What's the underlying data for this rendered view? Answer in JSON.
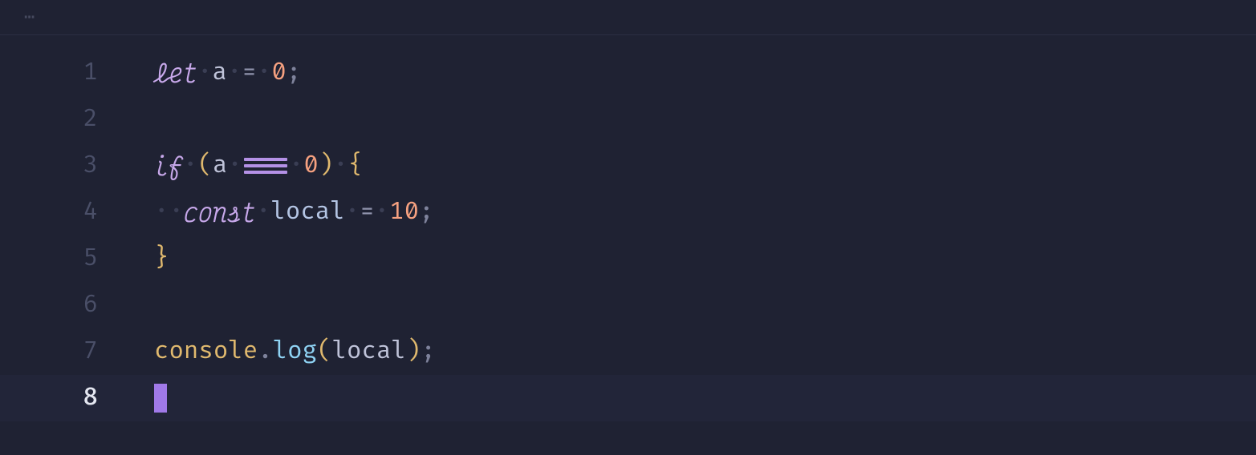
{
  "tabbar": {
    "ellipsis": "⋯"
  },
  "lines": [
    {
      "num": "1"
    },
    {
      "num": "2"
    },
    {
      "num": "3"
    },
    {
      "num": "4"
    },
    {
      "num": "5"
    },
    {
      "num": "6"
    },
    {
      "num": "7"
    },
    {
      "num": "8"
    }
  ],
  "code": {
    "l1": {
      "kw": "let",
      "sp": "·",
      "ident": "a",
      "op_eq": "=",
      "num": "0",
      "semi": ";"
    },
    "l3": {
      "kw": "if",
      "sp": "·",
      "lp": "(",
      "ident": "a",
      "num": "0",
      "rp": ")",
      "lb": "{"
    },
    "l4": {
      "indent": "··",
      "kw": "const",
      "sp": "·",
      "ident": "local",
      "op_eq": "=",
      "num": "10",
      "semi": ";"
    },
    "l5": {
      "rb": "}"
    },
    "l7": {
      "obj": "console",
      "dot": ".",
      "method": "log",
      "lp": "(",
      "ident": "local",
      "rp": ")",
      "semi": ";"
    }
  },
  "colors": {
    "background": "#1f2233",
    "active_line": "#222539",
    "cursor": "#a079e8",
    "keyword": "#c7a8ea",
    "number": "#f6a180",
    "brace": "#e0b96e",
    "method": "#8fd3f4",
    "gutter": "#4a4f68"
  }
}
